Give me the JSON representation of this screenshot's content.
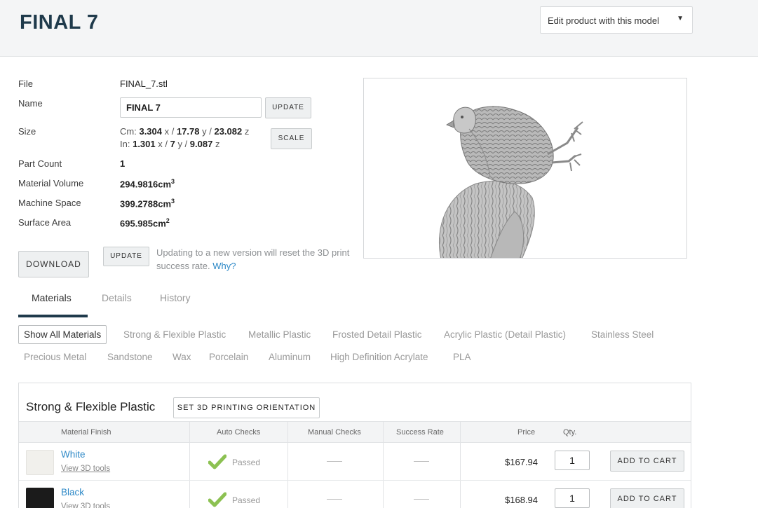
{
  "header": {
    "title": "FINAL 7",
    "edit_select": "Edit product with this model"
  },
  "info": {
    "file_label": "File",
    "file_value": "FINAL_7.stl",
    "name_label": "Name",
    "name_value": "FINAL 7",
    "name_update": "UPDATE",
    "size_label": "Size",
    "cm_prefix": "Cm:",
    "cm_x": "3.304",
    "cm_y": "17.78",
    "cm_z": "23.082",
    "in_prefix": "In:",
    "in_x": "1.301",
    "in_y": "7",
    "in_z": "9.087",
    "scale_button": "SCALE",
    "part_count_label": "Part Count",
    "part_count_value": "1",
    "material_volume_label": "Material Volume",
    "material_volume_value": "294.9816cm",
    "machine_space_label": "Machine Space",
    "machine_space_value": "399.2788cm",
    "surface_area_label": "Surface Area",
    "surface_area_value": "695.985cm",
    "cubed": "3",
    "squared": "2"
  },
  "actions": {
    "download": "DOWNLOAD",
    "update": "UPDATE",
    "note": "Updating to a new version will reset the 3D print success rate.",
    "why_link": "Why?"
  },
  "tabs": [
    "Materials",
    "Details",
    "History"
  ],
  "filters": {
    "row1": [
      "Show All Materials",
      "Strong & Flexible Plastic",
      "Metallic Plastic",
      "Frosted Detail Plastic",
      "Acrylic Plastic (Detail Plastic)",
      "Stainless Steel"
    ],
    "row2": [
      "Precious Metal",
      "Sandstone",
      "Wax",
      "Porcelain",
      "Aluminum",
      "High Definition Acrylate",
      "PLA"
    ]
  },
  "panel": {
    "title": "Strong & Flexible Plastic",
    "orientation_button": "SET 3D PRINTING ORIENTATION",
    "columns": [
      "Material Finish",
      "Auto Checks",
      "Manual Checks",
      "Success Rate",
      "Price",
      "Qty."
    ],
    "rows": [
      {
        "name": "White",
        "tools": "View 3D tools",
        "auto": "Passed",
        "price": "$167.94",
        "qty": "1",
        "cart": "ADD TO CART",
        "swatch": "#f1f0ec"
      },
      {
        "name": "Black",
        "tools": "View 3D tools",
        "auto": "Passed",
        "price": "$168.94",
        "qty": "1",
        "cart": "ADD TO CART",
        "swatch": "#1b1b1b"
      }
    ]
  },
  "colors": {
    "accent": "#2e89c7",
    "title": "#1f3a4b",
    "check": "#8cc152"
  }
}
